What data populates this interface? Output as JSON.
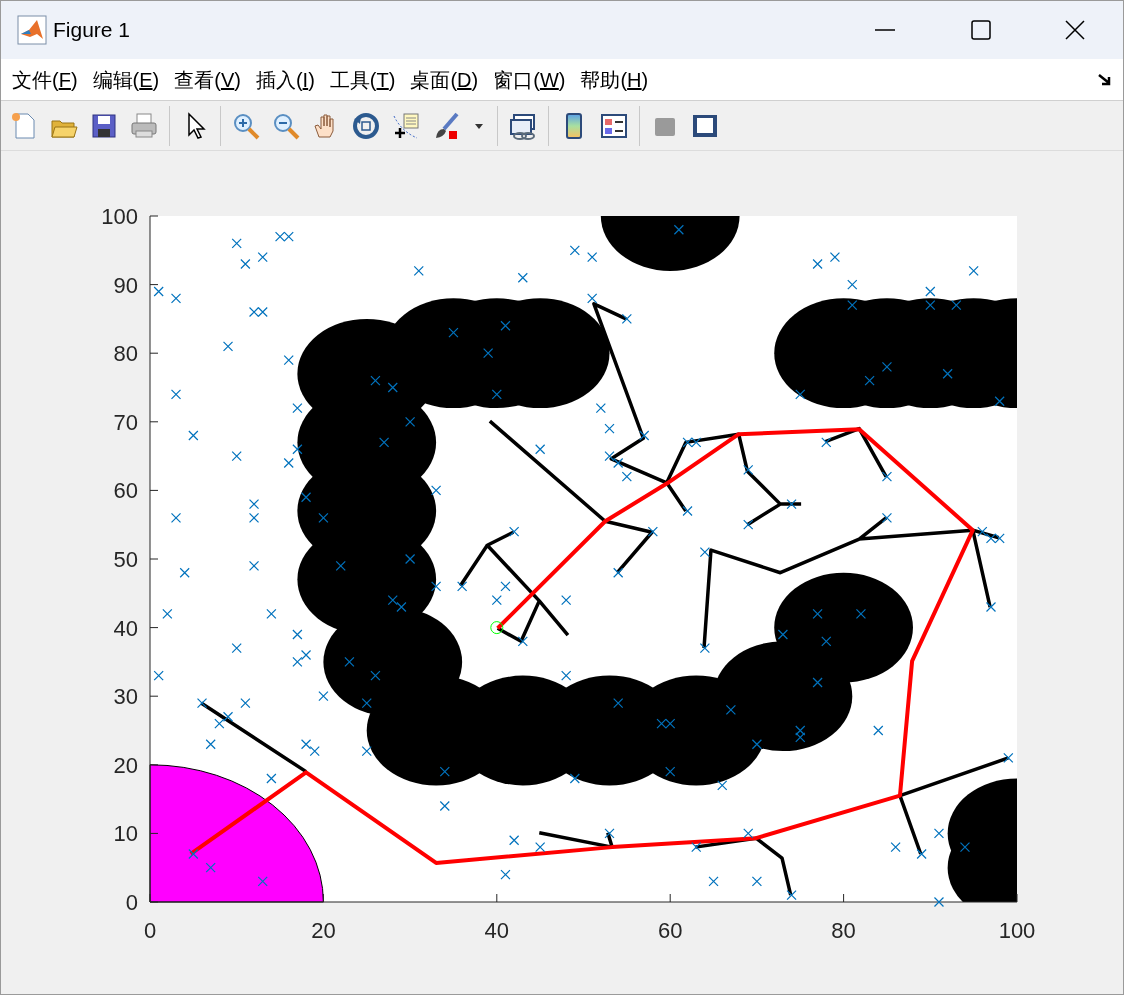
{
  "window": {
    "title": "Figure 1"
  },
  "menu": [
    {
      "label": "文件(F)"
    },
    {
      "label": "编辑(E)"
    },
    {
      "label": "查看(V)"
    },
    {
      "label": "插入(I)"
    },
    {
      "label": "工具(T)"
    },
    {
      "label": "桌面(D)"
    },
    {
      "label": "窗口(W)"
    },
    {
      "label": "帮助(H)"
    }
  ],
  "axes": {
    "chart_data": {
      "type": "scatter",
      "xlim": [
        0,
        100
      ],
      "ylim": [
        0,
        100
      ],
      "xticks": [
        0,
        20,
        40,
        60,
        80,
        100
      ],
      "yticks": [
        0,
        10,
        20,
        30,
        40,
        50,
        60,
        70,
        80,
        90,
        100
      ],
      "x": [
        1,
        3,
        10,
        11,
        13,
        15,
        16,
        9,
        12,
        13,
        3,
        5,
        10,
        3,
        4,
        2,
        1,
        10,
        12,
        12,
        12,
        14,
        16,
        16,
        17,
        17,
        18,
        20,
        22,
        17,
        17,
        18,
        23,
        20,
        26,
        25,
        25,
        6,
        11,
        9,
        8,
        7,
        14,
        18,
        19,
        5,
        7,
        13,
        26,
        28,
        27,
        30,
        31,
        35,
        33,
        30,
        28,
        29,
        33,
        36,
        39,
        40,
        41,
        43,
        45,
        49,
        51,
        51,
        55,
        52,
        53,
        53,
        54,
        57,
        55,
        61,
        40,
        41,
        42,
        43,
        48,
        48,
        49,
        54,
        53,
        45,
        42,
        41,
        34,
        34,
        59,
        60,
        60,
        63,
        65,
        66,
        67,
        69,
        70,
        70,
        74,
        73,
        75,
        75,
        77,
        77,
        78,
        82,
        84,
        86,
        89,
        91,
        91,
        94,
        99,
        64,
        64,
        58,
        54,
        62,
        62,
        63,
        69,
        69,
        74,
        75,
        78,
        77,
        79,
        81,
        81,
        83,
        85,
        85,
        85,
        90,
        90,
        93,
        92,
        95,
        98,
        96,
        97,
        98,
        97
      ],
      "series": [
        {
          "color": "#0072bd",
          "values": [
            89,
            88,
            96,
            93,
            94,
            97,
            97,
            81,
            86,
            86,
            74,
            68,
            65,
            56,
            48,
            42,
            33,
            37,
            58,
            56,
            49,
            42,
            64,
            79,
            72,
            66,
            59,
            56,
            49,
            39,
            35,
            36,
            35,
            30,
            33,
            29,
            22,
            29,
            29,
            27,
            26,
            23,
            18,
            23,
            22,
            7,
            5,
            3,
            76,
            75,
            67,
            70,
            92,
            83,
            60,
            50,
            44,
            43,
            46,
            46,
            80,
            74,
            84,
            91,
            66,
            95,
            94,
            88,
            85,
            72,
            69,
            65,
            64,
            68,
            62,
            98,
            44,
            46,
            54,
            38,
            44,
            33,
            18,
            29,
            10,
            8,
            9,
            4,
            19,
            14,
            26,
            26,
            19,
            8,
            3,
            17,
            28,
            10,
            23,
            3,
            1,
            39,
            25,
            24,
            32,
            42,
            38,
            42,
            25,
            8,
            7,
            10,
            0,
            8,
            21,
            51,
            37,
            54,
            48,
            57,
            67,
            67,
            63,
            55,
            58,
            74,
            67,
            93,
            94,
            90,
            87,
            76,
            78,
            62,
            56,
            89,
            87,
            87,
            77,
            92,
            73,
            54,
            53,
            53,
            43
          ]
        }
      ]
    }
  }
}
